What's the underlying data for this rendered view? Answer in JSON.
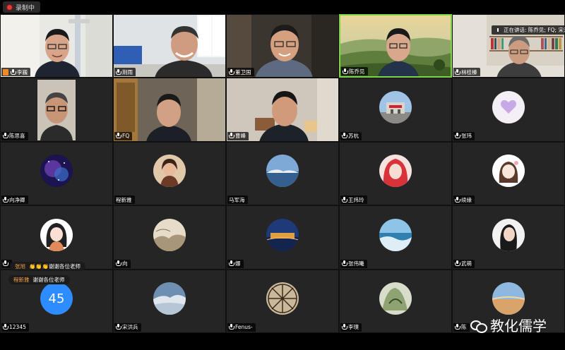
{
  "recording": {
    "label": "录制中"
  },
  "speaking": {
    "label": "正在讲话: 陈乔见; FQ; 宋洪"
  },
  "participants": [
    {
      "name": "李巍",
      "video": "camera",
      "muted": false,
      "flag": true
    },
    {
      "name": "荆雨",
      "video": "camera",
      "muted": false
    },
    {
      "name": "董卫国",
      "video": "camera",
      "muted": false
    },
    {
      "name": "陈乔见",
      "video": "camera",
      "muted": false,
      "active": true
    },
    {
      "name": "林桂榛",
      "video": "camera",
      "muted": false
    },
    {
      "name": "陈思喜",
      "video": "camera",
      "muted": false
    },
    {
      "name": "FQ",
      "video": "camera",
      "muted": false
    },
    {
      "name": "曹峰",
      "video": "camera",
      "muted": false
    },
    {
      "name": "苏杭",
      "video": "avatar",
      "muted": false
    },
    {
      "name": "张玮",
      "video": "avatar",
      "muted": false
    },
    {
      "name": "向净卿",
      "video": "avatar",
      "muted": false
    },
    {
      "name": "程新雅",
      "video": "avatar",
      "muted": false
    },
    {
      "name": "马军海",
      "video": "avatar",
      "muted": false
    },
    {
      "name": "王炜玲",
      "video": "avatar",
      "muted": false
    },
    {
      "name": "续缘",
      "video": "avatar",
      "muted": false
    },
    {
      "name": "",
      "video": "avatar",
      "muted": false
    },
    {
      "name": "向",
      "video": "avatar",
      "muted": false
    },
    {
      "name": "娜",
      "video": "avatar",
      "muted": false
    },
    {
      "name": "张伟曦",
      "video": "avatar",
      "muted": false
    },
    {
      "name": "武萌",
      "video": "avatar",
      "muted": false
    },
    {
      "name": "12345",
      "video": "number",
      "number": "45",
      "muted": false
    },
    {
      "name": "宋洪兵",
      "video": "avatar",
      "muted": false
    },
    {
      "name": "Fenus-",
      "video": "avatar",
      "muted": false
    },
    {
      "name": "李璞",
      "video": "avatar",
      "muted": false
    },
    {
      "name": "陈",
      "video": "avatar",
      "muted": false
    }
  ],
  "chat_messages": [
    {
      "sender": "张旭",
      "text": "👏👏👏谢谢各位老师"
    },
    {
      "sender": "程新雅",
      "text": "谢谢各位老师"
    }
  ],
  "watermark": {
    "text": "教化儒学"
  },
  "colors": {
    "active_border": "#7ed348",
    "tile_bg": "#252525",
    "number_avatar": "#2d8cff",
    "chat_sender": "#f0a048"
  }
}
